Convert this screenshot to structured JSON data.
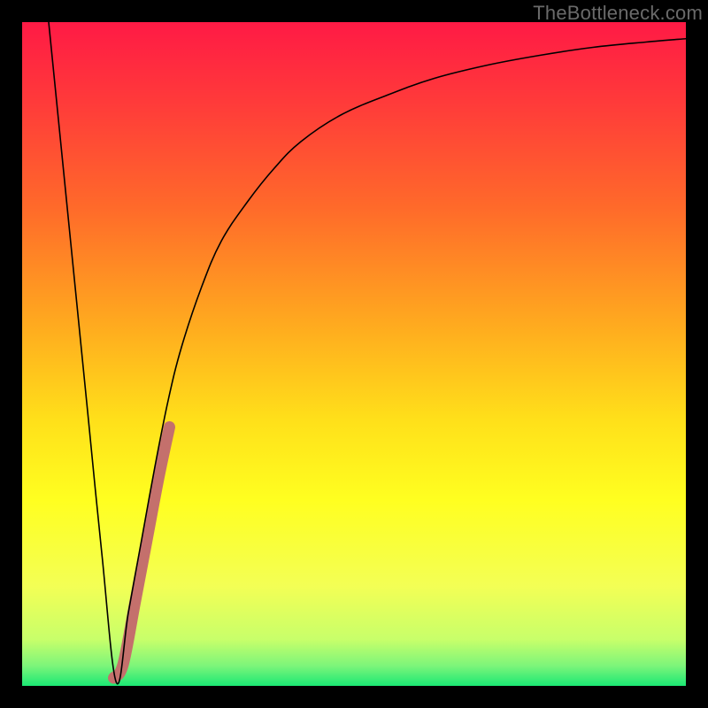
{
  "watermark": {
    "text": "TheBottleneck.com"
  },
  "frame": {
    "outer_w": 800,
    "outer_h": 800,
    "border_left": 25,
    "border_right": 25,
    "border_top": 25,
    "border_bottom": 25,
    "border_color": "#000000"
  },
  "gradient": {
    "stops": [
      {
        "pct": 0,
        "color": "#ff1a45"
      },
      {
        "pct": 12,
        "color": "#ff3a3a"
      },
      {
        "pct": 28,
        "color": "#ff6a2a"
      },
      {
        "pct": 45,
        "color": "#ffa81f"
      },
      {
        "pct": 60,
        "color": "#ffe01a"
      },
      {
        "pct": 72,
        "color": "#ffff20"
      },
      {
        "pct": 85,
        "color": "#f3ff55"
      },
      {
        "pct": 93,
        "color": "#c8ff6a"
      },
      {
        "pct": 97,
        "color": "#7cf57a"
      },
      {
        "pct": 100,
        "color": "#1be874"
      }
    ]
  },
  "chart_data": {
    "type": "line",
    "title": "",
    "xlabel": "",
    "ylabel": "",
    "xlim": [
      0,
      100
    ],
    "ylim": [
      0,
      100
    ],
    "note": "Values read as percentages of plot area; (0,0) is bottom-left. y roughly corresponds to bottleneck severity (0=green/none, 100=red/severe).",
    "optimum_x": 14.2,
    "series": [
      {
        "name": "bottleneck-curve",
        "color": "#000000",
        "stroke_width": 1.6,
        "x": [
          4,
          6,
          8,
          10,
          12,
          14.2,
          16,
          18,
          20,
          22,
          24,
          27,
          30,
          34,
          38,
          42,
          48,
          55,
          62,
          70,
          78,
          86,
          94,
          100
        ],
        "y": [
          100,
          80,
          60,
          40,
          20,
          0.5,
          11,
          22,
          33,
          43,
          51,
          60,
          67,
          73,
          78,
          82,
          86,
          89,
          91.5,
          93.5,
          95,
          96.2,
          97,
          97.5
        ]
      },
      {
        "name": "highlight-segment",
        "color": "#c4706c",
        "stroke_width": 13,
        "linecap": "round",
        "x": [
          13.8,
          15.2,
          17.0,
          18.8,
          20.6,
          22.2
        ],
        "y": [
          1.2,
          3.2,
          12.5,
          22.0,
          31.5,
          39.0
        ]
      }
    ]
  }
}
